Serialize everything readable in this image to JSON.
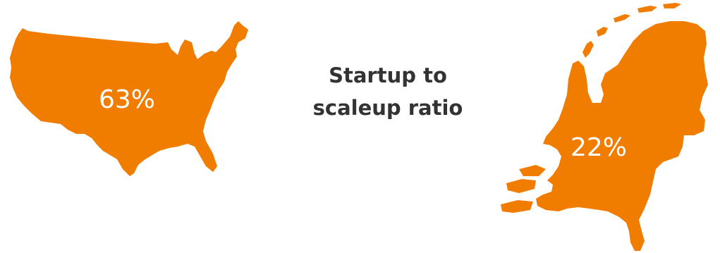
{
  "title": {
    "line1": "Startup to",
    "line2": "scaleup ratio"
  },
  "maps": {
    "usa": {
      "icon": "usa-map-icon",
      "value": "63%"
    },
    "netherlands": {
      "icon": "netherlands-map-icon",
      "value": "22%"
    }
  },
  "colors": {
    "map_fill": "#F07D00",
    "value_text": "#FFFFFF",
    "title_text": "#333333",
    "background": "#FFFFFF"
  }
}
